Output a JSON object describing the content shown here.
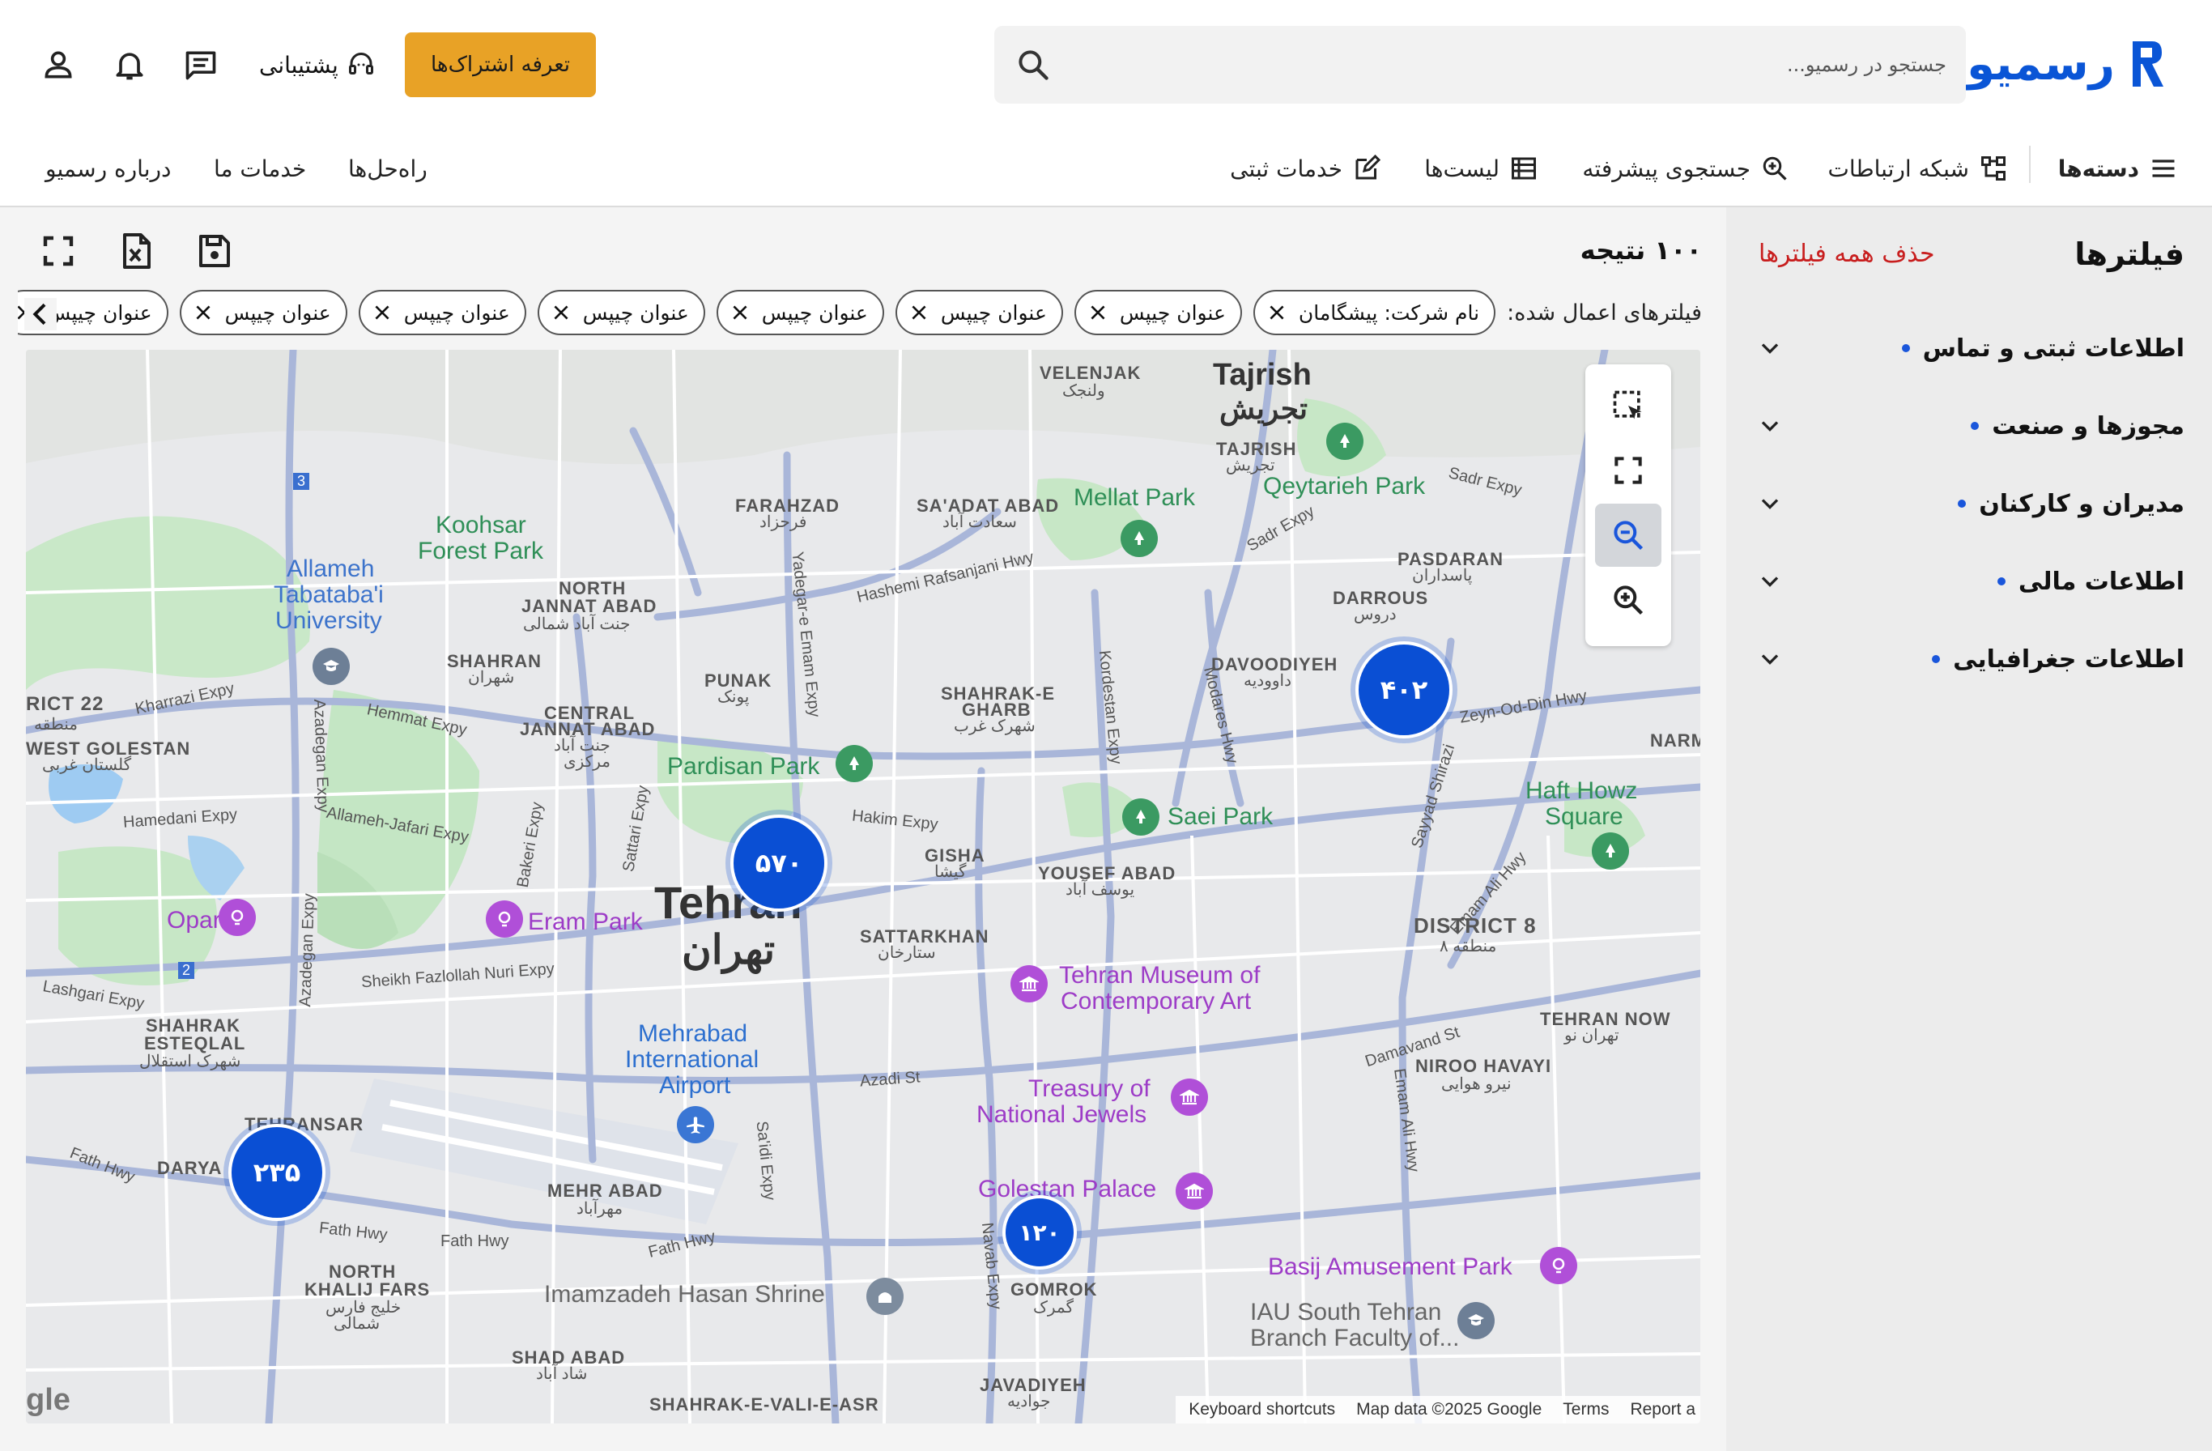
{
  "brand": {
    "name": "رسمیو",
    "color": "#0a55d6"
  },
  "search": {
    "placeholder": "جستجو در رسمیو..."
  },
  "header": {
    "plan_button": "تعرفه اشتراک‌ها",
    "support": "پشتیبانی",
    "icons": [
      "headset-icon",
      "chat-icon",
      "bell-icon",
      "user-icon"
    ]
  },
  "nav": {
    "categories": "دسته‌ها",
    "network": "شبکه ارتباطات",
    "advanced_search": "جستجوی پیشرفته",
    "lists": "لیست‌ها",
    "registration": "خدمات ثبتی",
    "solutions": "راه‌حل‌ها",
    "services": "خدمات ما",
    "about": "درباره رسمیو"
  },
  "sidebar": {
    "title": "فیلترها",
    "clear_all": "حذف همه فیلترها",
    "items": [
      {
        "label": "اطلاعات ثبتی و تماس"
      },
      {
        "label": "مجوزها و صنعت"
      },
      {
        "label": "مدیران و کارکنان"
      },
      {
        "label": "اطلاعات مالی"
      },
      {
        "label": "اطلاعات جغرافیایی"
      }
    ]
  },
  "results": {
    "count_label": "۱۰۰ نتیجه"
  },
  "filters": {
    "applied_label": "فیلترهای اعمال شده:",
    "chips": [
      {
        "label": "نام شرکت: پیشگامان"
      },
      {
        "label": "عنوان چیپس"
      },
      {
        "label": "عنوان چیپس"
      },
      {
        "label": "عنوان چیپس"
      },
      {
        "label": "عنوان چیپس"
      },
      {
        "label": "عنوان چیپس"
      },
      {
        "label": "عنوان چیپس"
      },
      {
        "label": "عنوان چیپس"
      }
    ]
  },
  "map": {
    "clusters": [
      {
        "label": "۴۰۲"
      },
      {
        "label": "۵۷۰"
      },
      {
        "label": "۲۳۵"
      },
      {
        "label": "۱۲۰"
      }
    ],
    "labels": {
      "tehran_en": "Tehran",
      "tehran_fa": "تهران",
      "tajrish_en": "Tajrish",
      "tajrish_fa": "تجریش",
      "velenjak": "VELENJAK",
      "velenjak_fa": "ولنجک",
      "tajrish_small": "TAJRISH",
      "tajrish_small_fa": "تجریش",
      "farahzad": "FARAHZAD",
      "farahzad_fa": "فرحزاد",
      "saadat_abad": "SA'ADAT ABAD",
      "saadat_abad_fa": "سعادت آباد",
      "mellat_park": "Mellat Park",
      "qeytarieh_park": "Qeytarieh Park",
      "pasdaran": "PASDARAN",
      "pasdaran_fa": "پاسداران",
      "darrous": "DARROUS",
      "darrous_fa": "دروس",
      "koohsar": "Koohsar",
      "koohsar2": "Forest Park",
      "allameh1": "Allameh",
      "allameh2": "Tabataba'i",
      "allameh3": "University",
      "north_jannat": "NORTH",
      "north_jannat2": "JANNAT ABAD",
      "north_jannat_fa": "جنت آباد شمالی",
      "shahran": "SHAHRAN",
      "shahran_fa": "شهران",
      "punak": "PUNAK",
      "punak_fa": "پونک",
      "shahrak_gharb": "SHAHRAK-E",
      "shahrak_gharb2": "GHARB",
      "shahrak_gharb_fa": "شهرک غرب",
      "davoodiyeh": "DAVOODIYEH",
      "davoodiyeh_fa": "داوودیه",
      "central_jannat": "CENTRAL",
      "central_jannat2": "JANNAT ABAD",
      "central_jannat_fa": "جنت آباد",
      "central_jannat_fa2": "مرکزی",
      "district22": "RICT 22",
      "district22_fa": "منطقه",
      "west_golestan": "WEST GOLESTAN",
      "west_golestan_fa": "گلستان غربی",
      "pardisan": "Pardisan Park",
      "saei": "Saei Park",
      "haft_howz": "Haft Howz",
      "haft_howz2": "Square",
      "narm": "NARM",
      "gisha": "GISHA",
      "gisha_fa": "گیشا",
      "yousef_abad": "YOUSEF ABAD",
      "yousef_abad_fa": "یوسف آباد",
      "opark": "Opark",
      "eram_park": "Eram Park",
      "sattarkhan": "SATTARKHAN",
      "sattarkhan_fa": "ستارخان",
      "district8": "DISTRICT 8",
      "district8_fa": "منطقه ۸",
      "museum1": "Tehran Museum of",
      "museum2": "Contemporary Art",
      "mehrabad1": "Mehrabad",
      "mehrabad2": "International",
      "mehrabad3": "Airport",
      "shahrak_esteqlal": "SHAHRAK",
      "shahrak_esteqlal2": "ESTEQLAL",
      "shahrak_esteqlal_fa": "شهرک استقلال",
      "treasury1": "Treasury of",
      "treasury2": "National Jewels",
      "tehran_now": "TEHRAN NOW",
      "tehran_now_fa": "تهران نو",
      "niroo_havaei": "NIROO HAVAYI",
      "niroo_havaei_fa": "نیرو هوایی",
      "tehransar": "TEHRANSAR",
      "darya": "DARYA",
      "mehr_abad": "MEHR ABAD",
      "mehr_abad_fa": "مهرآباد",
      "golestan_palace": "Golestan Palace",
      "basij": "Basij Amusement Park",
      "north_khalij": "NORTH",
      "north_khalij2": "KHALIJ FARS",
      "north_khalij_fa": "خلیج فارس",
      "north_khalij_fa2": "شمالی",
      "imamzadeh": "Imamzadeh Hasan Shrine",
      "gomrok": "GOMROK",
      "gomrok_fa": "گمرک",
      "iau1": "IAU South Tehran",
      "iau2": "Branch Faculty of...",
      "shad_abad": "SHAD ABAD",
      "shad_abad_fa": "شاد آباد",
      "javadiyeh": "JAVADIYEH",
      "javadiyeh_fa": "جوادیه",
      "shahrak_vali": "SHAHRAK-E-VALI-E-ASR",
      "road_hashemi": "Hashemi Rafsanjani Hwy",
      "road_kharrazi": "Kharrazi Expy",
      "road_hemmat": "Hemmat Expy",
      "road_hamedani": "Hamedani Expy",
      "road_allameh_jafari": "Allameh-Jafari Expy",
      "road_hakim": "Hakim Expy",
      "road_sheikh": "Sheikh Fazlollah Nuri Expy",
      "road_lashgari": "Lashgari Expy",
      "road_azadi": "Azadi St",
      "road_fath": "Fath Hwy",
      "road_damavand": "Damavand St",
      "road_zeyn": "Zeyn-Od-Din Hwy",
      "road_sadr": "Sadr Expy",
      "road_emam_ali": "Emam Ali Hwy",
      "road_sayyad": "Sayyad Shirazi",
      "road_azadegan": "Azadegan Expy",
      "road_navab": "Navab Expy",
      "road_saidi": "Sa'idi Expy",
      "road_yadegar": "Yadegar-e Emam Expy",
      "road_kordestan": "Kordestan Expy",
      "road_modares": "Modares Hwy",
      "road_bakeri": "Bakeri Expy",
      "road_sattari": "Sattari Expy",
      "shield_3": "3",
      "shield_2": "2"
    },
    "footer": {
      "shortcuts": "Keyboard shortcuts",
      "data": "Map data ©2025 Google",
      "terms": "Terms",
      "report": "Report a"
    },
    "google_mark": "gle"
  },
  "colors": {
    "accent": "#0a55d6",
    "plan": "#e8a226",
    "danger": "#c81e1e",
    "cluster": "#0a4fd4"
  }
}
